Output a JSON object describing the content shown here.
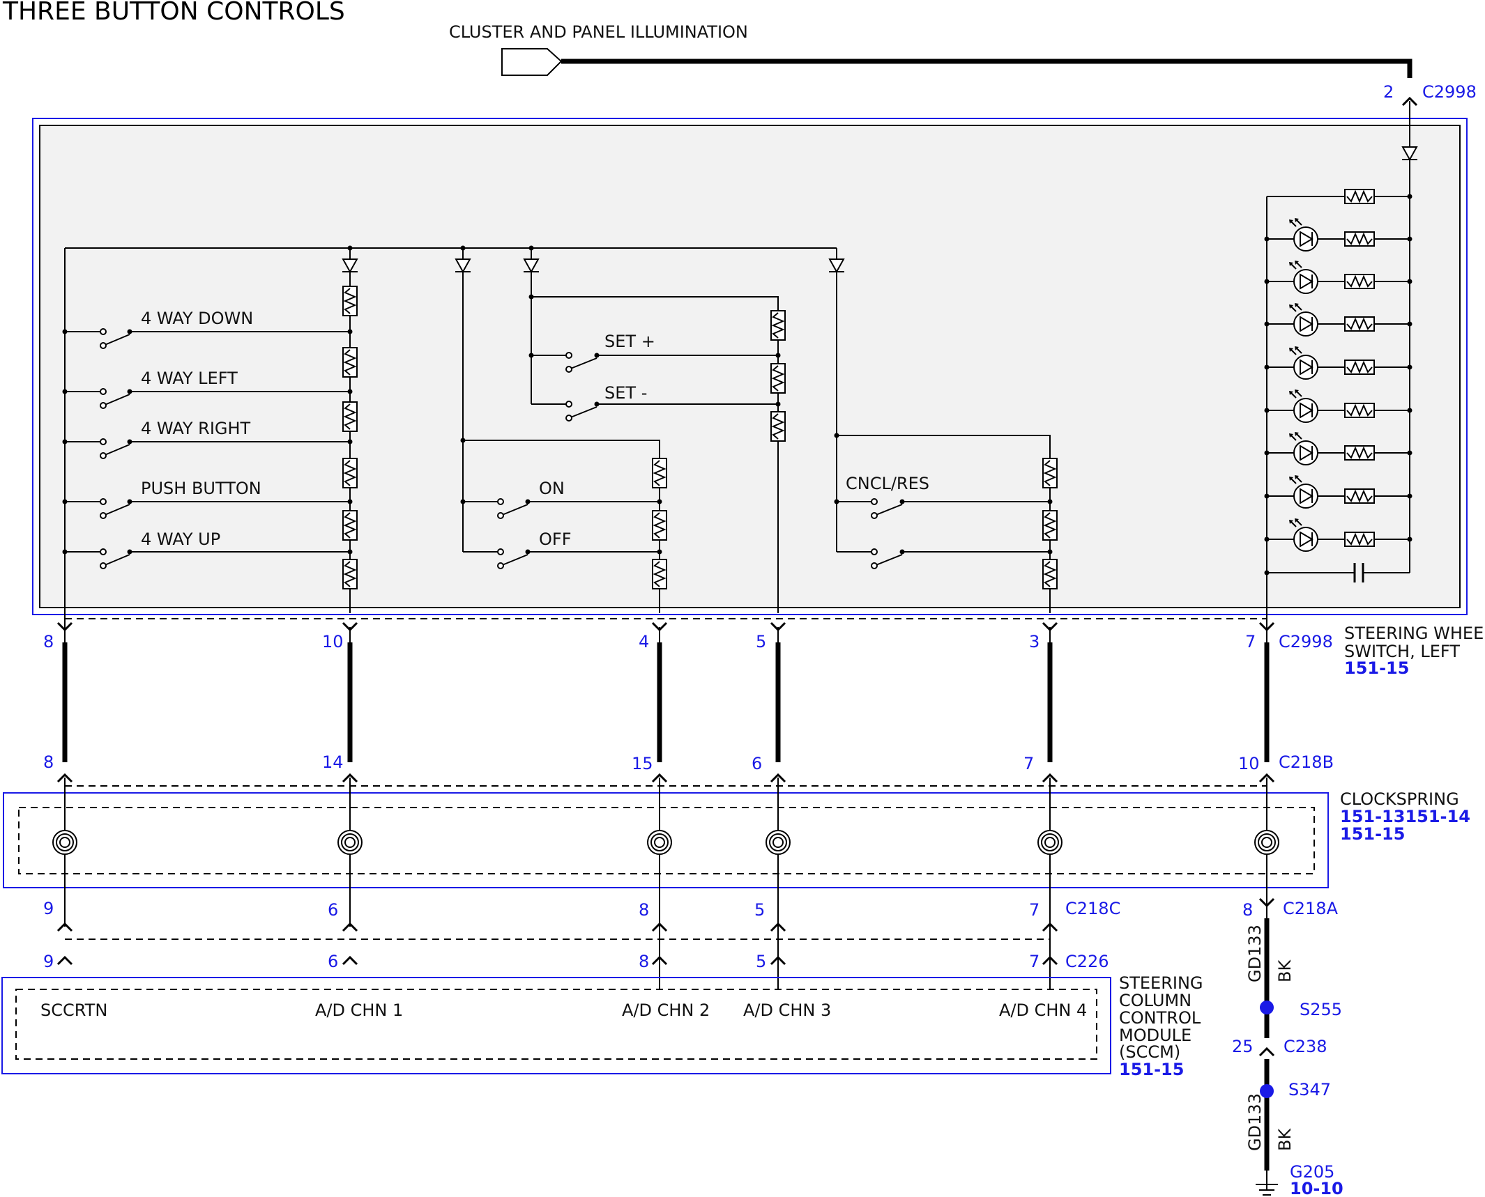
{
  "title": "THREE BUTTON CONTROLS",
  "feed": {
    "label": "CLUSTER AND PANEL ILLUMINATION",
    "pin": "2",
    "connector": "C2998"
  },
  "switch_module": {
    "name_lines": [
      "STEERING WHEEL",
      "SWITCH, LEFT"
    ],
    "ref": "151-15",
    "bottom_connector": "C2998",
    "switches": [
      "4 WAY DOWN",
      "4 WAY LEFT",
      "4 WAY RIGHT",
      "PUSH BUTTON",
      "4 WAY UP",
      "SET +",
      "SET -",
      "ON",
      "OFF",
      "CNCL/RES"
    ]
  },
  "clockspring": {
    "name": "CLOCKSPRING",
    "refs": [
      "151-13151-14",
      "151-15"
    ],
    "top_connector": "C218B",
    "bottom_connector": "C218C",
    "ground_connector": "C218A"
  },
  "sccm": {
    "name_lines": [
      "STEERING",
      "COLUMN",
      "CONTROL",
      "MODULE",
      "(SCCM)"
    ],
    "ref": "151-15",
    "connector": "C226",
    "pins": [
      "SCCRTN",
      "A/D CHN 1",
      "A/D CHN 2",
      "A/D CHN 3",
      "A/D CHN 4"
    ]
  },
  "circuits": [
    {
      "swl_pin": "8",
      "cs_in": "8",
      "cs_out": "9",
      "sccm_pin": "9"
    },
    {
      "swl_pin": "10",
      "cs_in": "14",
      "cs_out": "6",
      "sccm_pin": "6"
    },
    {
      "swl_pin": "4",
      "cs_in": "15",
      "cs_out": "8",
      "sccm_pin": "8"
    },
    {
      "swl_pin": "5",
      "cs_in": "6",
      "cs_out": "5",
      "sccm_pin": "5"
    },
    {
      "swl_pin": "3",
      "cs_in": "7",
      "cs_out": "7",
      "sccm_pin": "7"
    },
    {
      "swl_pin": "7",
      "cs_in": "10",
      "cs_out": "8",
      "sccm_pin": ""
    }
  ],
  "ground": {
    "wire": "GD133",
    "color": "BK",
    "splice1": "S255",
    "pin2": "25",
    "connector2": "C238",
    "splice2": "S347",
    "ground_point": "G205",
    "ref": "10-10"
  },
  "colors": {
    "accent": "#1a1ae6",
    "module_fill": "#f2f2f2"
  }
}
